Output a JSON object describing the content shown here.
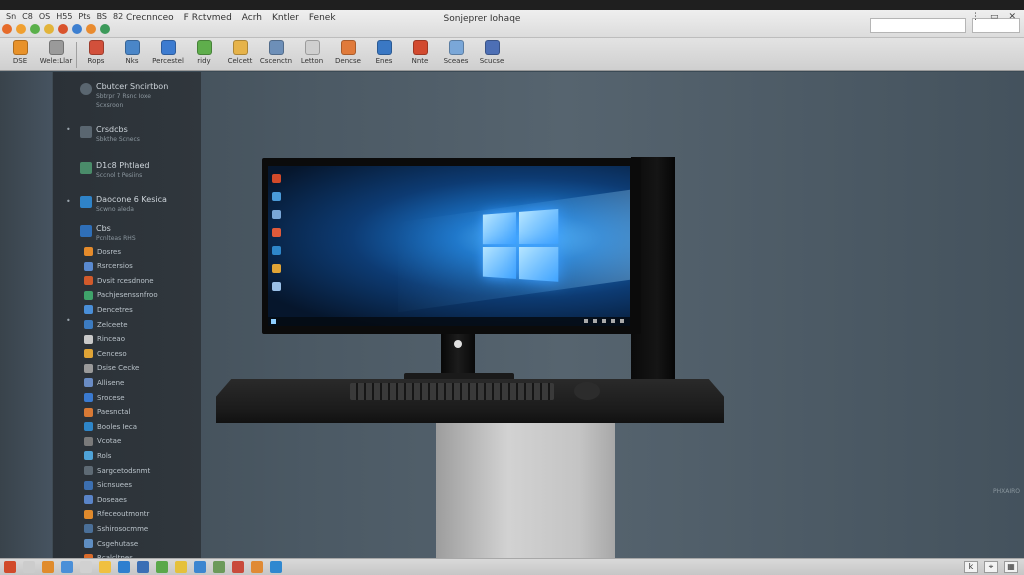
{
  "window": {
    "title": "Sonjeprer Iohaqe"
  },
  "menubar": {
    "left_items": [
      "Sn",
      "C8",
      "OS",
      "H55",
      "Pts",
      "BS",
      "82"
    ],
    "main_items": [
      "Crecnnceo",
      "F Rctvmed",
      "Acrh",
      "Kntler",
      "Fenek"
    ]
  },
  "window_controls": [
    "⋮",
    "▭",
    "✕"
  ],
  "toolbar": {
    "tools": [
      {
        "label": "DSE",
        "icon": "tool-icon-1",
        "color": "#e8922a"
      },
      {
        "label": "Wele:Llar",
        "icon": "tool-icon-2",
        "color": "#9a9a9a"
      },
      {
        "label": "Rops",
        "icon": "tool-icon-3",
        "color": "#d2503b"
      },
      {
        "label": "Nks",
        "icon": "tool-icon-4",
        "color": "#4a86c8"
      },
      {
        "label": "Percestel",
        "icon": "tool-icon-5",
        "color": "#3c7bd0"
      },
      {
        "label": "ridy",
        "icon": "tool-icon-6",
        "color": "#5fae4c"
      },
      {
        "label": "Celcett",
        "icon": "tool-icon-7",
        "color": "#e6b34a"
      },
      {
        "label": "Cscenctn",
        "icon": "tool-icon-8",
        "color": "#6d8fb8"
      },
      {
        "label": "Letton",
        "icon": "tool-icon-9",
        "color": "#cfcfcf"
      },
      {
        "label": "Dencse",
        "icon": "tool-icon-10",
        "color": "#e07a3a"
      },
      {
        "label": "Enes",
        "icon": "tool-icon-11",
        "color": "#3a78c4"
      },
      {
        "label": "Nnte",
        "icon": "tool-icon-12",
        "color": "#d24a2f"
      },
      {
        "label": "Sceaes",
        "icon": "tool-icon-13",
        "color": "#7aa7d8"
      },
      {
        "label": "Scucse",
        "icon": "tool-icon-14",
        "color": "#4d6fb5"
      }
    ]
  },
  "sidebar": {
    "headers": [
      {
        "title": "Cbutcer Sncirtbon",
        "subtitle": "Sbtrpr 7 Rsnc Ioxe",
        "sub2": "Scxsroon",
        "color": "#5a6670",
        "icon": "disc-icon"
      },
      {
        "title": "Crsdcbs",
        "subtitle": "Sbkthe Scnecs",
        "color": "#5a6670",
        "icon": "folder-icon"
      },
      {
        "title": "D1c8 Phtlaed",
        "subtitle": "Sccnol t Pesiins",
        "color": "#4a8c6a",
        "icon": "monitor-icon"
      },
      {
        "title": "Daocone 6 Kesica",
        "subtitle": "Scwno aleda",
        "color": "#2f83c8",
        "icon": "app-icon"
      }
    ],
    "list_header": {
      "title": "Cbs",
      "subtitle": "Pcnlteas RHS",
      "icon": "list-icon"
    },
    "items": [
      {
        "label": "Dosres",
        "color": "#e58b2b",
        "icon": "item-icon-1"
      },
      {
        "label": "Rsrcersios",
        "color": "#5a8ad0",
        "icon": "item-icon-2"
      },
      {
        "label": "Dvsit rcesdnone",
        "color": "#d25a2b",
        "icon": "item-icon-3"
      },
      {
        "label": "Pachjesenssnfroo",
        "color": "#3fa36a",
        "icon": "item-icon-4"
      },
      {
        "label": "Dencetres",
        "color": "#4a8fd8",
        "icon": "item-icon-5"
      },
      {
        "label": "Zelceete",
        "color": "#3c7bc0",
        "icon": "item-icon-6"
      },
      {
        "label": "Rinceao",
        "color": "#c9c9c9",
        "icon": "item-icon-7"
      },
      {
        "label": "Cenceso",
        "color": "#e0a436",
        "icon": "item-icon-8"
      },
      {
        "label": "Dsise Cecke",
        "color": "#9a9a9a",
        "icon": "item-icon-9"
      },
      {
        "label": "Allisene",
        "color": "#6a8cc4",
        "icon": "item-icon-10"
      },
      {
        "label": "Srocese",
        "color": "#3a7ad0",
        "icon": "item-icon-11"
      },
      {
        "label": "Paesnctal",
        "color": "#d97a35",
        "icon": "item-icon-12"
      },
      {
        "label": "Booles Ieca",
        "color": "#2e86c9",
        "icon": "item-icon-13"
      },
      {
        "label": "Vcotae",
        "color": "#7a7a7a",
        "icon": "item-icon-14"
      },
      {
        "label": "Rols",
        "color": "#4fa3d8",
        "icon": "item-icon-15"
      },
      {
        "label": "Sargcetodsnmt",
        "color": "#5e6a74",
        "icon": "item-icon-16"
      },
      {
        "label": "Sicnsuees",
        "color": "#3c6fb0",
        "icon": "item-icon-17"
      },
      {
        "label": "Doseaes",
        "color": "#5a84c8",
        "icon": "item-icon-18"
      },
      {
        "label": "Rfeceoutmontr",
        "color": "#e08a2c",
        "icon": "item-icon-19"
      },
      {
        "label": "Sshirosocmme",
        "color": "#4a6f98",
        "icon": "item-icon-20"
      },
      {
        "label": "Csgehutase",
        "color": "#5f8ec2",
        "icon": "item-icon-21"
      },
      {
        "label": "Rcalcltnes",
        "color": "#d96a2a",
        "icon": "item-icon-22"
      }
    ]
  },
  "scene": {
    "watermark": "PHXAIRO"
  },
  "taskbar": {
    "icons": [
      {
        "color": "#d14a2a",
        "icon": "taskbar-icon-1"
      },
      {
        "color": "#cccccc",
        "icon": "taskbar-icon-2"
      },
      {
        "color": "#e08b2c",
        "icon": "taskbar-icon-3"
      },
      {
        "color": "#4a8fd8",
        "icon": "taskbar-icon-4"
      },
      {
        "color": "#d1d1d1",
        "icon": "taskbar-icon-5"
      },
      {
        "color": "#f0c040",
        "icon": "taskbar-icon-6"
      },
      {
        "color": "#2e7fcf",
        "icon": "taskbar-icon-7"
      },
      {
        "color": "#3b6fb5",
        "icon": "taskbar-icon-8"
      },
      {
        "color": "#5aa84a",
        "icon": "taskbar-icon-9"
      },
      {
        "color": "#e5c13c",
        "icon": "taskbar-icon-10"
      },
      {
        "color": "#3d86d0",
        "icon": "taskbar-icon-11"
      },
      {
        "color": "#6c9a5a",
        "icon": "taskbar-icon-12"
      },
      {
        "color": "#c94a3b",
        "icon": "taskbar-icon-13"
      },
      {
        "color": "#e08a35",
        "icon": "taskbar-icon-14"
      },
      {
        "color": "#2f88d0",
        "icon": "taskbar-icon-15"
      }
    ],
    "right_buttons": [
      "k",
      "⌖",
      "▦"
    ]
  }
}
